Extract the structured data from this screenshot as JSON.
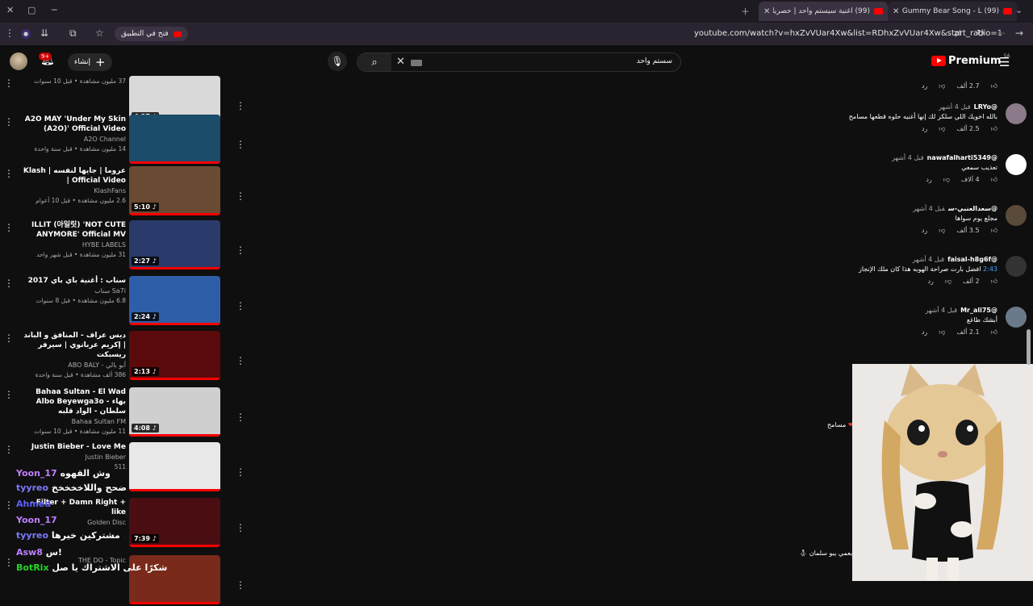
{
  "browser": {
    "tabs": [
      {
        "title": "(99) The Gummy Bear Song - L"
      },
      {
        "title": "(99) اغنية سيستم واحد | حصرياً"
      }
    ],
    "url": "youtube.com/watch?v=hxZvVUar4Xw&list=RDhxZvVUar4Xw&start_radio=1",
    "open_in_app": "فتح في التطبيق"
  },
  "header": {
    "logo_text": "Premium",
    "logo_region": "SA",
    "search_query": "سستم واحد",
    "create_label": "إنشاء",
    "notification_count": "9+"
  },
  "recommendations": [
    {
      "title": "",
      "channel": "",
      "meta": "37 مليون مشاهدة • قبل 10 سنوات",
      "duration": "4:27",
      "thumb": "#d9d9d9"
    },
    {
      "title": "A2O MAY 'Under My Skin (A2O)' Official Video",
      "channel": "A2O Channel",
      "meta": "14 مليون مشاهدة • قبل سنة واحدة",
      "duration": "",
      "thumb": "#1b4c69"
    },
    {
      "title": "Klash | عروما | جايها لنفسه | Official Video",
      "channel": "KlashFans",
      "meta": "2.6 مليون مشاهدة • قبل 10 أعوام",
      "duration": "5:10",
      "thumb": "#6a4a32"
    },
    {
      "title": "ILLIT (아일릿) 'NOT CUTE ANYMORE' Official MV",
      "channel": "HYBE LABELS",
      "meta": "31 مليون مشاهدة • قبل شهر واحد",
      "duration": "2:27",
      "thumb": "#2a3a6a"
    },
    {
      "title": "سناب : أغنية باي باي 2017",
      "channel": "سناب Sa7i",
      "meta": "6.8 مليون مشاهدة • قبل 8 سنوات",
      "duration": "2:24",
      "thumb": "#2f5ea8"
    },
    {
      "title": "ديس عراف - المنافق و الباند | إكريم عربانوي | سيرفر ريسبكت",
      "channel": "ABO BALY - أبو بالي",
      "meta": "386 ألف مشاهدة • قبل سنة واحدة",
      "duration": "2:13",
      "thumb": "#5a0a0a"
    },
    {
      "title": "Bahaa Sultan - El Wad Albo Beyewga3o - بهاء سلطان - الواد قلبه",
      "channel": "Bahaa Sultan FM",
      "meta": "11 مليون مشاهدة • قبل 10 سنوات",
      "duration": "4:08",
      "thumb": "#cfcfcf"
    },
    {
      "title": "Justin Bieber - Love Me",
      "channel": "Justin Bieber",
      "meta": "511",
      "duration": "",
      "thumb": "#e8e8e8"
    },
    {
      "title": "- Filter + Damn Right + like",
      "channel": "Golden Disc",
      "meta": "",
      "duration": "7:39",
      "thumb": "#4a0d12"
    },
    {
      "title": "",
      "channel": "THE DO - Topic",
      "meta": "",
      "duration": "",
      "thumb": "#7a2a1a"
    }
  ],
  "comments": [
    {
      "author": "",
      "time": "",
      "text": "",
      "likes": "2.7 ألف",
      "reply": "رد",
      "avatar": "#444"
    },
    {
      "author": "@LRYo",
      "time": "قبل 4 أشهر",
      "text": "بالله اخويك اللي سلكر لك إنها أغنيه حلوه قطعها مسامح",
      "likes": "2.5 ألف",
      "reply": "رد",
      "avatar": "#8a7a8a"
    },
    {
      "author": "@nawafalharti5349",
      "time": "قبل 4 أشهر",
      "text": "تعذيب سمعي",
      "likes": "4 آلاف",
      "reply": "رد",
      "avatar": "#ffffff"
    },
    {
      "author": "@سعدالعنبي-س",
      "time": "قبل 4 أشهر",
      "text": "مجلع يوم سواها",
      "likes": "3.5 ألف",
      "reply": "رد",
      "avatar": "#5a4a3a"
    },
    {
      "author": "@faisal-h8g6f",
      "time": "قبل 4 أشهر",
      "text": "افضل بارت صراحة الهوبه هذا كان ملك الإنجاز",
      "timestamp": "2:43",
      "likes": "2 ألف",
      "reply": "رد",
      "avatar": "#333"
    },
    {
      "author": "@Mr_ali75",
      "time": "قبل 4 أشهر",
      "text": "أبشك طاغع",
      "likes": "2.1 ألف",
      "reply": "رد",
      "avatar": "#6a7a8a"
    }
  ],
  "chat_overlay": [
    {
      "user": "Yoon_17",
      "msg": "وش القهوه",
      "color": "#c080ff"
    },
    {
      "user": "tyyreo",
      "msg": "ضحح واللاخخخخخ",
      "color": "#7a7aff"
    },
    {
      "user": "Ahmed",
      "msg": "",
      "color": "#6060ff"
    },
    {
      "user": "Yoon_17",
      "msg": "",
      "color": "#c080ff"
    },
    {
      "user": "tyyreo",
      "msg": "مشتركين خيرها",
      "color": "#7a7aff"
    },
    {
      "user": "Asw8",
      "msg": "س!",
      "color": "#c080ff"
    },
    {
      "user": "BotRix",
      "msg": "شكرًا على الاشتراك يا صل",
      "color": "#22d622"
    }
  ],
  "notes": {
    "heart_note": "مسامح",
    "bottom_note": "بعمي يبو سلمان"
  }
}
